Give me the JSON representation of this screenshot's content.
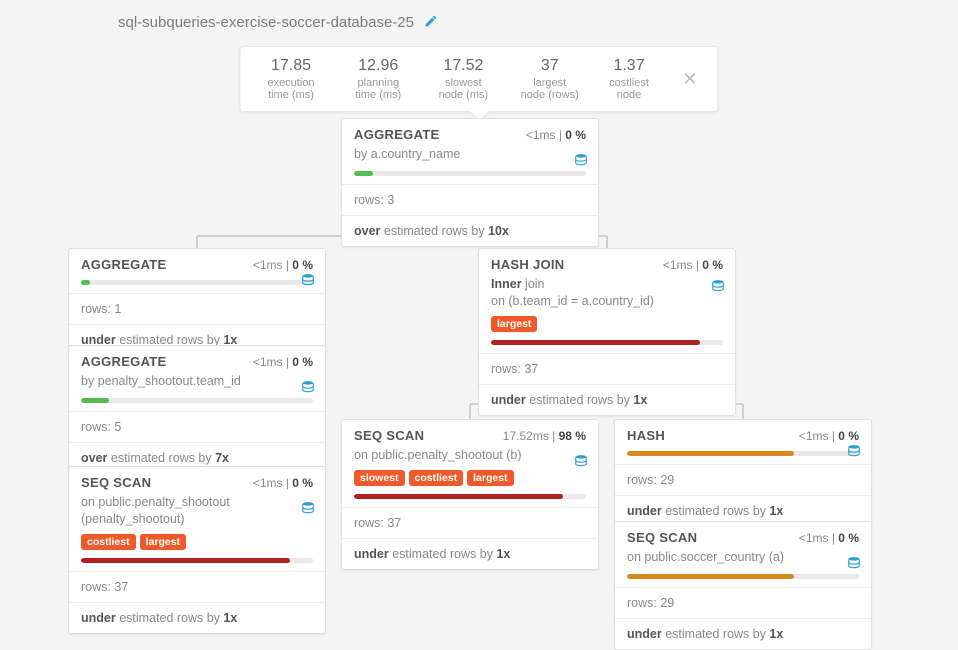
{
  "title": "sql-subqueries-exercise-soccer-database-25",
  "stats": {
    "exec_time": {
      "value": "17.85",
      "label": "execution time (ms)"
    },
    "plan_time": {
      "value": "12.96",
      "label": "planning time (ms)"
    },
    "slowest": {
      "value": "17.52",
      "label": "slowest node (ms)"
    },
    "largest": {
      "value": "37",
      "label": "largest node (rows)"
    },
    "costliest": {
      "value": "1.37",
      "label": "costliest node"
    }
  },
  "time_lt1": "<1ms",
  "n0": {
    "op": "AGGREGATE",
    "pct": "0",
    "by": "a.country_name",
    "rows": "3",
    "est_dir": "over",
    "est_x": "10"
  },
  "n1": {
    "op": "AGGREGATE",
    "pct": "0",
    "rows": "1",
    "est_dir": "under",
    "est_x": "1"
  },
  "n2": {
    "op": "HASH JOIN",
    "pct": "0",
    "join_kind": "Inner",
    "join_word": "join",
    "on": "(b.team_id = a.country_id)",
    "tag": "largest",
    "rows": "37",
    "est_dir": "under",
    "est_x": "1"
  },
  "n3": {
    "op": "AGGREGATE",
    "pct": "0",
    "by": "penalty_shootout.team_id",
    "rows": "5",
    "est_dir": "over",
    "est_x": "7"
  },
  "n4": {
    "op": "SEQ SCAN",
    "time": "17.52ms",
    "pct": "98",
    "on": "public.penalty_shootout (b)",
    "tag1": "slowest",
    "tag2": "costliest",
    "tag3": "largest",
    "rows": "37",
    "est_dir": "under",
    "est_x": "1"
  },
  "n5": {
    "op": "HASH",
    "pct": "0",
    "rows": "29",
    "est_dir": "under",
    "est_x": "1"
  },
  "n6": {
    "op": "SEQ SCAN",
    "pct": "0",
    "on": "public.penalty_shootout (penalty_shootout)",
    "tag1": "costliest",
    "tag2": "largest",
    "rows": "37",
    "est_dir": "under",
    "est_x": "1"
  },
  "n7": {
    "op": "SEQ SCAN",
    "pct": "0",
    "on": "public.soccer_country (a)",
    "rows": "29",
    "est_dir": "under",
    "est_x": "1"
  }
}
